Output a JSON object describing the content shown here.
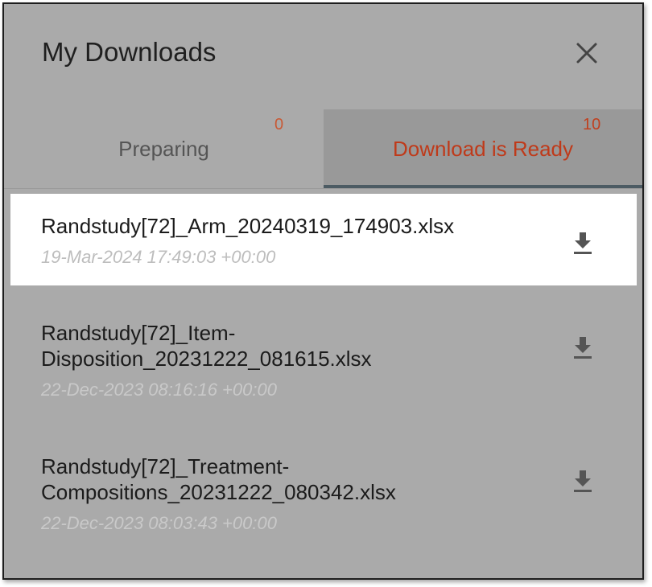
{
  "header": {
    "title": "My Downloads",
    "close_icon": "close-icon"
  },
  "tabs": [
    {
      "label": "Preparing",
      "count": "0",
      "active": false
    },
    {
      "label": "Download is Ready",
      "count": "10",
      "active": true
    }
  ],
  "downloads": [
    {
      "name": "Randstudy[72]_Arm_20240319_174903.xlsx",
      "date": "19-Mar-2024 17:49:03 +00:00",
      "selected": true,
      "icon": "download-icon"
    },
    {
      "name_line1": "Randstudy[72]_Item-",
      "name_line2": "Disposition_20231222_081615.xlsx",
      "date": "22-Dec-2023 08:16:16 +00:00",
      "selected": false,
      "icon": "download-icon"
    },
    {
      "name_line1": "Randstudy[72]_Treatment-",
      "name_line2": "Compositions_20231222_080342.xlsx",
      "date": "22-Dec-2023 08:03:43 +00:00",
      "selected": false,
      "icon": "download-icon"
    }
  ],
  "colors": {
    "accent": "#bf3a1a",
    "count": "#c85a36",
    "overlay": "#aaaaaa",
    "selected_bg": "#ffffff"
  }
}
